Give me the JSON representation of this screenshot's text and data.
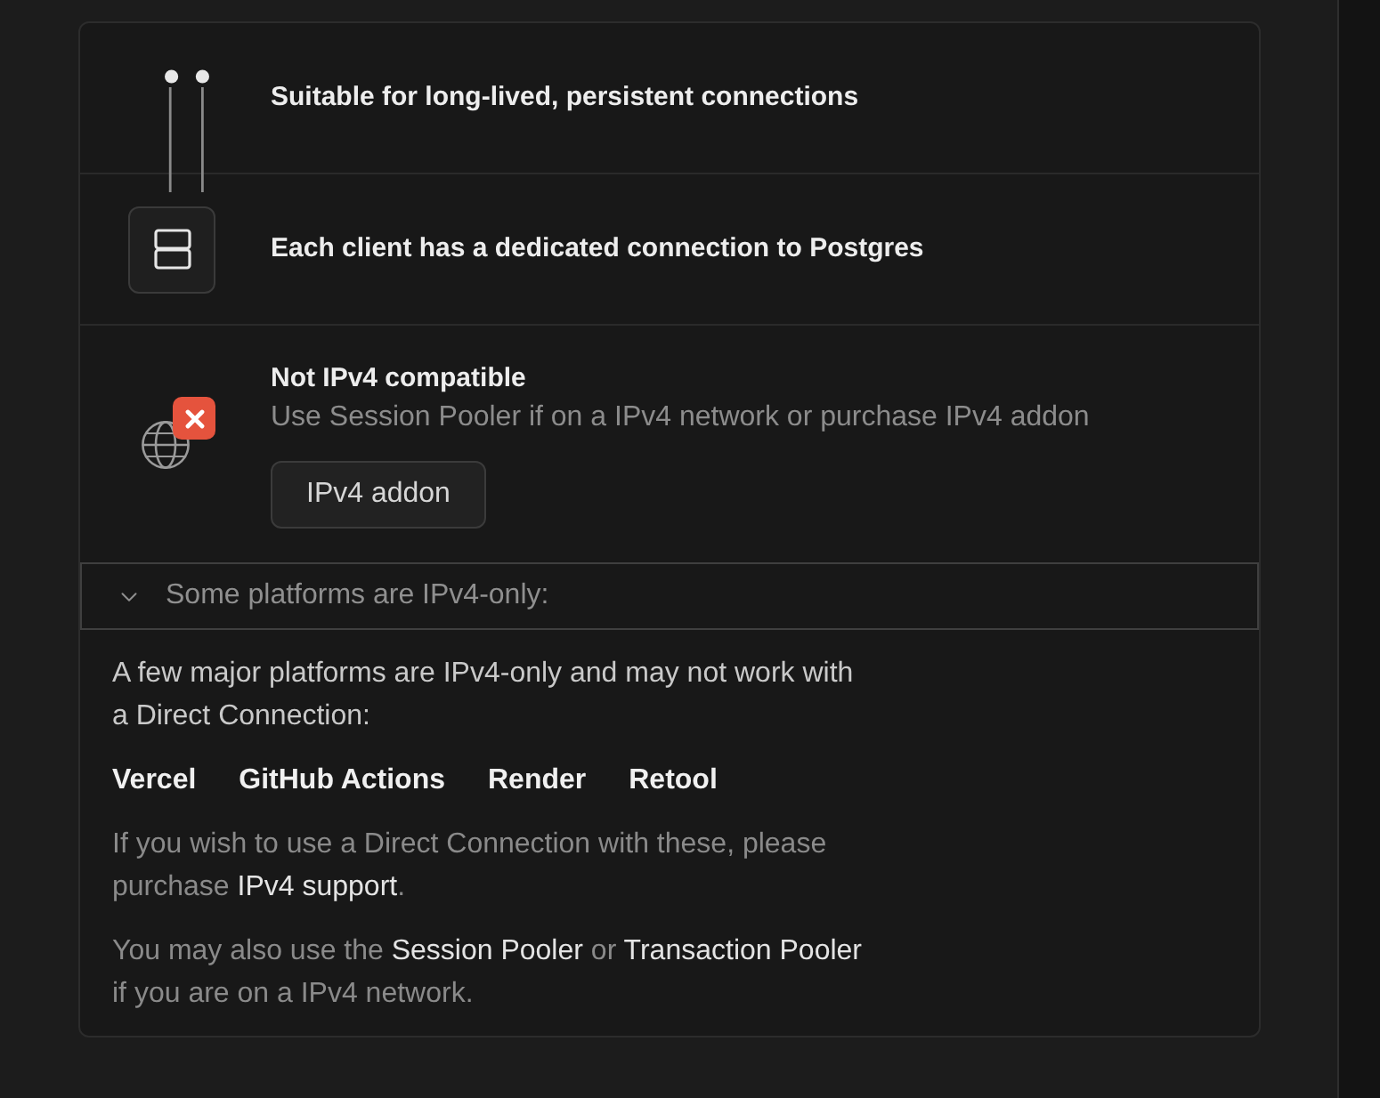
{
  "features": [
    {
      "kind": "connection",
      "text": "Suitable for long-lived, persistent connections"
    },
    {
      "kind": "server",
      "text": "Each client has a dedicated connection to Postgres"
    },
    {
      "kind": "warning",
      "title": "Not IPv4 compatible",
      "description": "Use Session Pooler if on a IPv4 network or purchase IPv4 addon",
      "button": "IPv4 addon"
    }
  ],
  "ipv4_notice": {
    "header": "Some platforms are IPv4-only:",
    "expanded": true,
    "intro": "A few major platforms are IPv4-only and may not work with a Direct Connection:",
    "platforms": [
      "Vercel",
      "GitHub Actions",
      "Render",
      "Retool"
    ],
    "notes": [
      {
        "parts": [
          {
            "kind": "text",
            "text": "If you wish to use a Direct Connection with these, please purchase "
          },
          {
            "kind": "link",
            "text": "IPv4 support"
          },
          {
            "kind": "text",
            "text": "."
          }
        ]
      },
      {
        "parts": [
          {
            "kind": "text",
            "text": "You may also use the "
          },
          {
            "kind": "link",
            "text": "Session Pooler"
          },
          {
            "kind": "text",
            "text": " or "
          },
          {
            "kind": "link",
            "text": "Transaction Pooler"
          },
          {
            "kind": "text",
            "text": " if you are on a IPv4 network."
          }
        ]
      }
    ]
  }
}
